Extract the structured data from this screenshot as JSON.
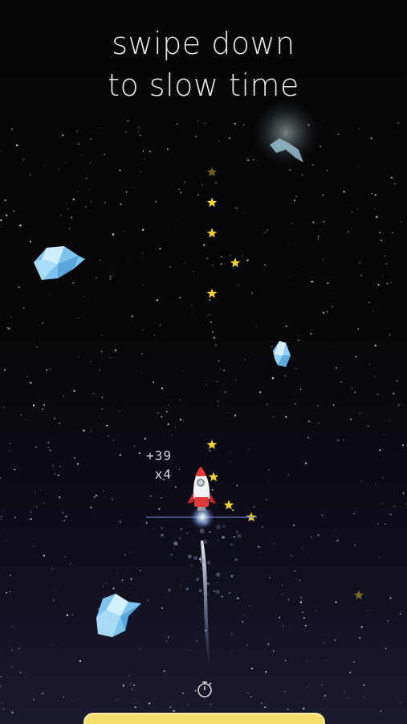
{
  "hint": {
    "line1": "swipe down",
    "line2": "to slow time"
  },
  "score": {
    "points": "+39",
    "multiplier": "x4"
  },
  "bottom_button": {
    "label": ""
  },
  "colors": {
    "space_top": "#050507",
    "space_bottom": "#1b1a2e",
    "collectible_star": "#f2d22e",
    "crystal": "#8fd0f5",
    "rocket_body": "#e23a3a",
    "button": "#f3dd6b"
  },
  "icons": [
    "rocket-icon",
    "star-icon",
    "crystal-asteroid-icon",
    "stopwatch-icon",
    "moon-glow-icon"
  ]
}
